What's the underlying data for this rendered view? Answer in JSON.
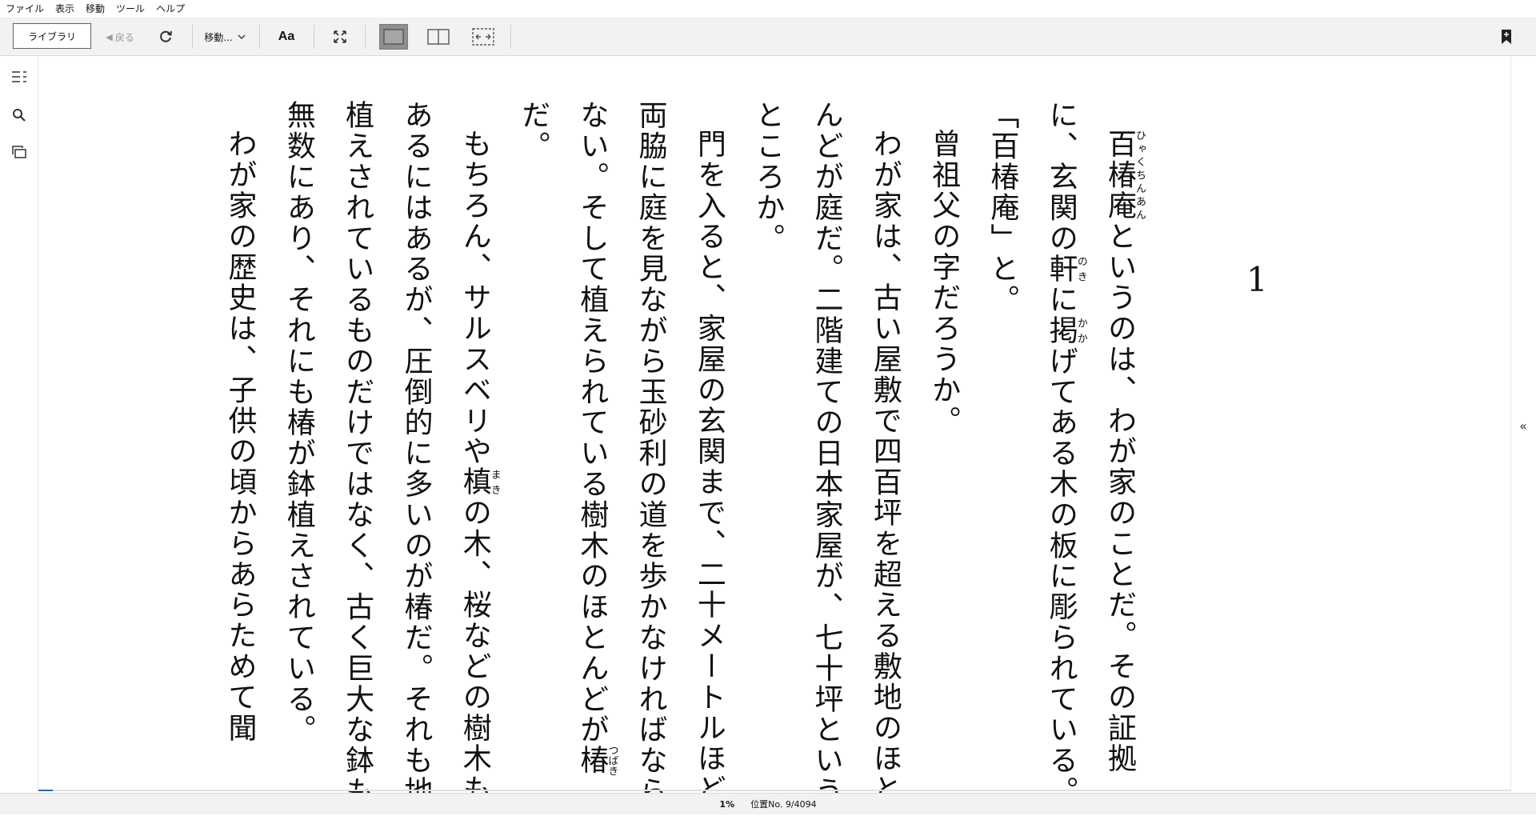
{
  "menu": [
    "ファイル",
    "表示",
    "移動",
    "ツール",
    "ヘルプ"
  ],
  "toolbar": {
    "library_label": "ライブラリ",
    "back_label": "戻る",
    "goto_label": "移動...",
    "aa_label": "Aa"
  },
  "icons": {
    "sync": "sync-icon",
    "fullscreen": "fullscreen-icon",
    "single_page": "single-page-view-icon",
    "two_page": "two-page-view-icon",
    "fit_page": "fit-width-view-icon",
    "bookmark": "bookmark-add-icon",
    "toc": "table-of-contents-icon",
    "search": "search-icon",
    "flashcards": "flashcards-icon"
  },
  "book": {
    "chapter_number": "1",
    "paragraphs": [
      {
        "indent": true,
        "segments": [
          {
            "text": "百椿庵",
            "ruby": "ひゃくちんあん"
          },
          {
            "text": "というのは、わが家のことだ。その証拠に、玄関の"
          },
          {
            "text": "軒",
            "ruby": "のき"
          },
          {
            "text": "に"
          },
          {
            "text": "掲",
            "ruby": "かか"
          },
          {
            "text": "げてある木の板に彫られている。"
          }
        ]
      },
      {
        "indent": false,
        "segments": [
          {
            "text": "「百椿庵」と。"
          }
        ]
      },
      {
        "indent": true,
        "segments": [
          {
            "text": "曾祖父の字だろうか。"
          }
        ]
      },
      {
        "indent": true,
        "segments": [
          {
            "text": "わが家は、古い屋敷で四百坪を超える敷地のほとんどが庭だ。二階建ての日本家屋が、七十坪というところか。"
          }
        ]
      },
      {
        "indent": true,
        "segments": [
          {
            "text": "門を入ると、家屋の玄関まで、二十メートルほど両脇に庭を見ながら玉砂利の道を歩かなければならない。そして植えられている樹木のほとんどが"
          },
          {
            "text": "椿",
            "ruby": "つばき"
          },
          {
            "text": "だ。"
          }
        ]
      },
      {
        "indent": true,
        "segments": [
          {
            "text": "もちろん、サルスベリや"
          },
          {
            "text": "槙",
            "ruby": "まき"
          },
          {
            "text": "の木、桜などの樹木もあるにはあるが、圧倒的に多いのが椿だ。それも地植えされているものだけではなく、古く巨大な鉢も無数にあり、それにも椿が鉢植えされている。"
          }
        ]
      },
      {
        "indent": true,
        "segments": [
          {
            "text": "わが家の歴史は、子供の頃からあらためて聞"
          }
        ]
      }
    ]
  },
  "status": {
    "percent": "1%",
    "location": "位置No. 9/4094",
    "progress_fraction": 0.01
  }
}
